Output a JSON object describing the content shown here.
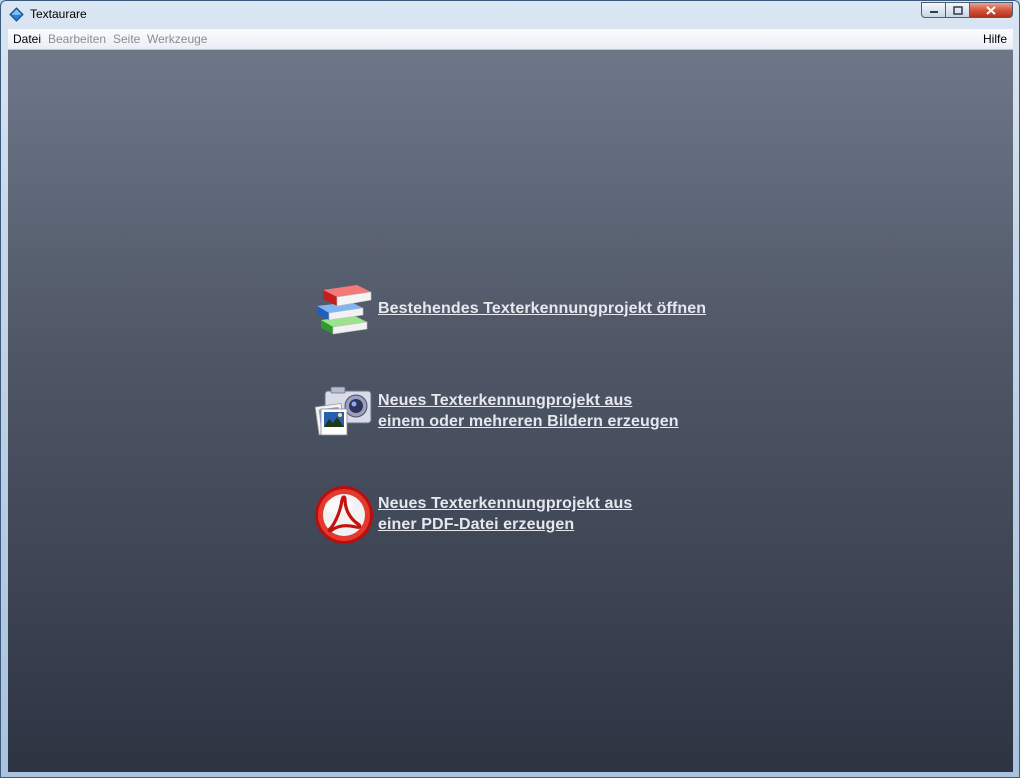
{
  "window": {
    "title": "Textaurare"
  },
  "menubar": {
    "items": [
      {
        "label": "Datei",
        "enabled": true
      },
      {
        "label": "Bearbeiten",
        "enabled": false
      },
      {
        "label": "Seite",
        "enabled": false
      },
      {
        "label": "Werkzeuge",
        "enabled": false
      }
    ],
    "help": "Hilfe"
  },
  "actions": {
    "open_project": {
      "line1": "Bestehendes Texterkennungprojekt öffnen",
      "icon": "books-icon"
    },
    "new_from_images": {
      "line1": "Neues Texterkennungprojekt aus",
      "line2": "einem oder mehreren Bildern erzeugen",
      "icon": "camera-photos-icon"
    },
    "new_from_pdf": {
      "line1": "Neues Texterkennungprojekt aus",
      "line2": "einer PDF-Datei erzeugen",
      "icon": "pdf-icon"
    }
  }
}
